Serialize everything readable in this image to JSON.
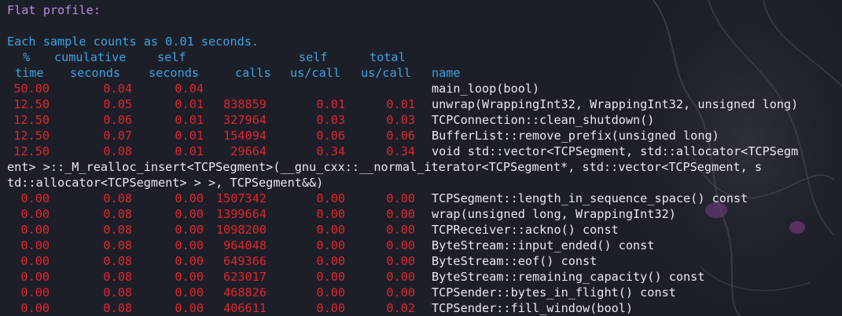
{
  "terminal": {
    "title_line": "Flat profile:",
    "sample_line": "Each sample counts as 0.01 seconds.",
    "header1": [
      "%",
      "cumulative",
      "self",
      "",
      "self",
      "total",
      ""
    ],
    "header2": [
      "time",
      "seconds",
      "seconds",
      "calls",
      "us/call",
      "us/call",
      "name"
    ],
    "rows": [
      {
        "time": "50.00",
        "cum": "0.04",
        "self": "0.04",
        "calls": "",
        "selfcall": "",
        "totalcall": "",
        "name": "main_loop(bool)"
      },
      {
        "time": "12.50",
        "cum": "0.05",
        "self": "0.01",
        "calls": "838859",
        "selfcall": "0.01",
        "totalcall": "0.01",
        "name": "unwrap(WrappingInt32, WrappingInt32, unsigned long)"
      },
      {
        "time": "12.50",
        "cum": "0.06",
        "self": "0.01",
        "calls": "327964",
        "selfcall": "0.03",
        "totalcall": "0.03",
        "name": "TCPConnection::clean_shutdown()"
      },
      {
        "time": "12.50",
        "cum": "0.07",
        "self": "0.01",
        "calls": "154094",
        "selfcall": "0.06",
        "totalcall": "0.06",
        "name": "BufferList::remove_prefix(unsigned long)"
      },
      {
        "time": "12.50",
        "cum": "0.08",
        "self": "0.01",
        "calls": "29664",
        "selfcall": "0.34",
        "totalcall": "0.34",
        "name": "void std::vector<TCPSegment, std::allocator<TCPSegm"
      }
    ],
    "wrap_lines": [
      "ent> >::_M_realloc_insert<TCPSegment>(__gnu_cxx::__normal_iterator<TCPSegment*, std::vector<TCPSegment, s",
      "td::allocator<TCPSegment> > >, TCPSegment&&)"
    ],
    "rows2": [
      {
        "time": "0.00",
        "cum": "0.08",
        "self": "0.00",
        "calls": "1507342",
        "selfcall": "0.00",
        "totalcall": "0.00",
        "name": "TCPSegment::length_in_sequence_space() const"
      },
      {
        "time": "0.00",
        "cum": "0.08",
        "self": "0.00",
        "calls": "1399664",
        "selfcall": "0.00",
        "totalcall": "0.00",
        "name": "wrap(unsigned long, WrappingInt32)"
      },
      {
        "time": "0.00",
        "cum": "0.08",
        "self": "0.00",
        "calls": "1098200",
        "selfcall": "0.00",
        "totalcall": "0.00",
        "name": "TCPReceiver::ackno() const"
      },
      {
        "time": "0.00",
        "cum": "0.08",
        "self": "0.00",
        "calls": "964048",
        "selfcall": "0.00",
        "totalcall": "0.00",
        "name": "ByteStream::input_ended() const"
      },
      {
        "time": "0.00",
        "cum": "0.08",
        "self": "0.00",
        "calls": "649366",
        "selfcall": "0.00",
        "totalcall": "0.00",
        "name": "ByteStream::eof() const"
      },
      {
        "time": "0.00",
        "cum": "0.08",
        "self": "0.00",
        "calls": "623017",
        "selfcall": "0.00",
        "totalcall": "0.00",
        "name": "ByteStream::remaining_capacity() const"
      },
      {
        "time": "0.00",
        "cum": "0.08",
        "self": "0.00",
        "calls": "468826",
        "selfcall": "0.00",
        "totalcall": "0.00",
        "name": "TCPSender::bytes_in_flight() const"
      },
      {
        "time": "0.00",
        "cum": "0.08",
        "self": "0.00",
        "calls": "406611",
        "selfcall": "0.00",
        "totalcall": "0.02",
        "name": "TCPSender::fill_window(bool)"
      }
    ]
  },
  "colors": {
    "background": "#1d1f28",
    "heading": "#b78be0",
    "header": "#3aa3e6",
    "numbers": "#e0252c",
    "names": "#e8e8ee"
  }
}
